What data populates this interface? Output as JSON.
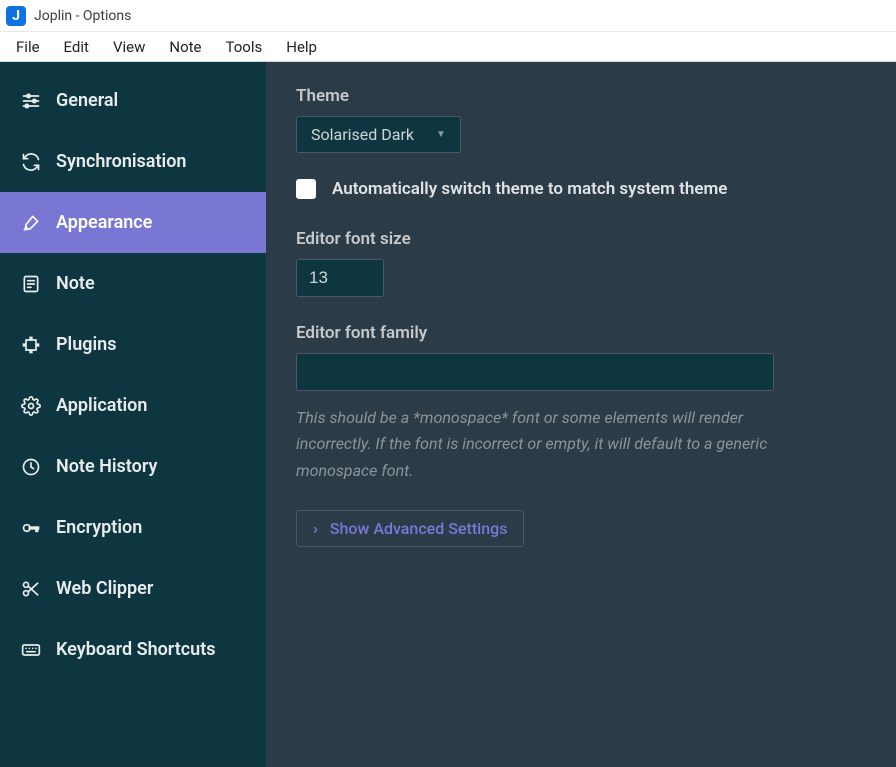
{
  "window": {
    "title": "Joplin - Options",
    "icon_letter": "J"
  },
  "menubar": [
    "File",
    "Edit",
    "View",
    "Note",
    "Tools",
    "Help"
  ],
  "sidebar": {
    "items": [
      {
        "id": "general",
        "label": "General"
      },
      {
        "id": "synchronisation",
        "label": "Synchronisation"
      },
      {
        "id": "appearance",
        "label": "Appearance"
      },
      {
        "id": "note",
        "label": "Note"
      },
      {
        "id": "plugins",
        "label": "Plugins"
      },
      {
        "id": "application",
        "label": "Application"
      },
      {
        "id": "note-history",
        "label": "Note History"
      },
      {
        "id": "encryption",
        "label": "Encryption"
      },
      {
        "id": "web-clipper",
        "label": "Web Clipper"
      },
      {
        "id": "keyboard-shortcuts",
        "label": "Keyboard Shortcuts"
      }
    ],
    "active": "appearance"
  },
  "form": {
    "theme": {
      "label": "Theme",
      "value": "Solarised Dark"
    },
    "auto_theme": {
      "label": "Automatically switch theme to match system theme",
      "checked": false
    },
    "font_size": {
      "label": "Editor font size",
      "value": "13"
    },
    "font_family": {
      "label": "Editor font family",
      "value": "",
      "help": "This should be a *monospace* font or some elements will render incorrectly. If the font is incorrect or empty, it will default to a generic monospace font."
    },
    "advanced": {
      "label": "Show Advanced Settings"
    }
  }
}
